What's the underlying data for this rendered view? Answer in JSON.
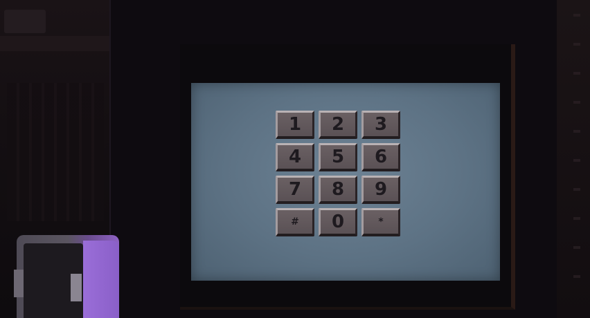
{
  "keypad": {
    "keys": [
      {
        "label": "1",
        "name": "key-1"
      },
      {
        "label": "2",
        "name": "key-2"
      },
      {
        "label": "3",
        "name": "key-3"
      },
      {
        "label": "4",
        "name": "key-4"
      },
      {
        "label": "5",
        "name": "key-5"
      },
      {
        "label": "6",
        "name": "key-6"
      },
      {
        "label": "7",
        "name": "key-7"
      },
      {
        "label": "8",
        "name": "key-8"
      },
      {
        "label": "9",
        "name": "key-9"
      },
      {
        "label": "#",
        "name": "key-hash"
      },
      {
        "label": "0",
        "name": "key-0"
      },
      {
        "label": "*",
        "name": "key-star"
      }
    ]
  },
  "colors": {
    "screen": "#5d7284",
    "key_face": "#5a5155",
    "key_text": "#1e1a1f",
    "device_accent": "#8e62c4"
  }
}
